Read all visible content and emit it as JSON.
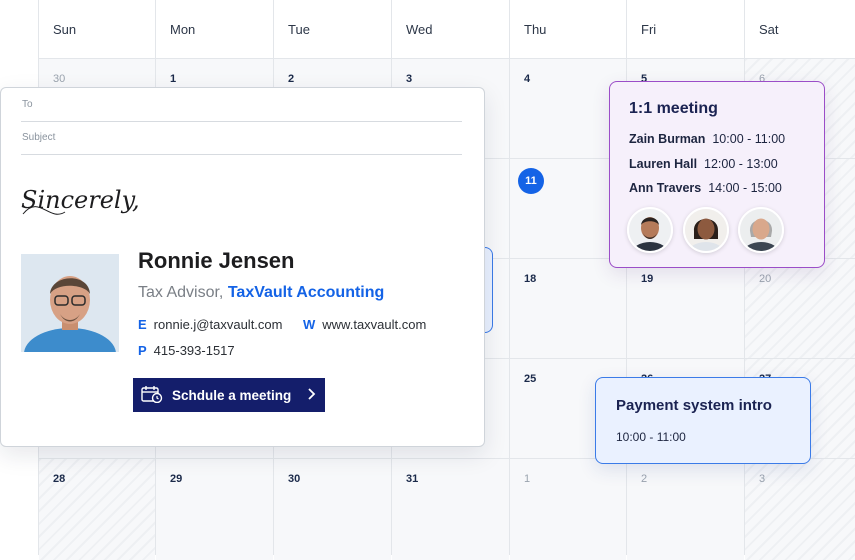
{
  "calendar": {
    "days_of_week": [
      "Sun",
      "Mon",
      "Tue",
      "Wed",
      "Thu",
      "Fri",
      "Sat"
    ],
    "weeks": [
      [
        "30",
        "1",
        "2",
        "3",
        "4",
        "5",
        "6"
      ],
      [
        "",
        "",
        "",
        "",
        "11",
        "",
        ""
      ],
      [
        "",
        "",
        "",
        "",
        "18",
        "19",
        "20"
      ],
      [
        "",
        "",
        "",
        "",
        "25",
        "26",
        "27"
      ],
      [
        "28",
        "29",
        "30",
        "31",
        "1",
        "2",
        "3"
      ]
    ],
    "today": "11"
  },
  "email": {
    "to_placeholder": "To",
    "subject_placeholder": "Subject",
    "signoff": "Sincerely,",
    "name": "Ronnie Jensen",
    "role": "Tax Advisor,",
    "company": "TaxVault Accounting",
    "email_key": "E",
    "email_value": "ronnie.j@taxvault.com",
    "web_key": "W",
    "web_value": "www.taxvault.com",
    "phone_key": "P",
    "phone_value": "415-393-1517",
    "cta_label": "Schdule a meeting"
  },
  "meeting_card": {
    "title": "1:1 meeting",
    "slots": [
      {
        "person": "Zain Burman",
        "time": "10:00 - 11:00"
      },
      {
        "person": "Lauren Hall",
        "time": "12:00 - 13:00"
      },
      {
        "person": "Ann Travers",
        "time": "14:00 - 15:00"
      }
    ]
  },
  "payment_card": {
    "title": "Payment system intro",
    "time": "10:00 - 11:00"
  },
  "colors": {
    "accent_blue": "#1463e6",
    "button_navy": "#141e6b",
    "meeting_purple": "#9b4dc8",
    "payment_blue": "#3b7be8"
  }
}
